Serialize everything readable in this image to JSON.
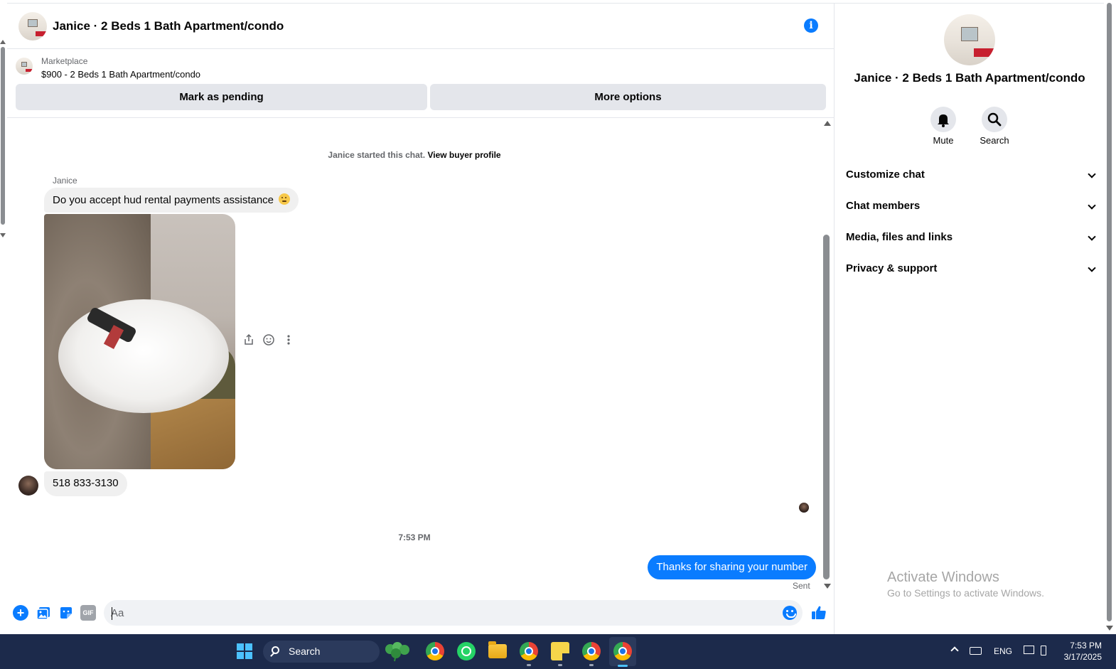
{
  "chat": {
    "title": "Janice · 2 Beds 1 Bath Apartment/condo",
    "info_icon": "info-icon"
  },
  "marketplace": {
    "label": "Marketplace",
    "item": "$900 - 2 Beds 1 Bath Apartment/condo",
    "mark_pending_label": "Mark as pending",
    "more_options_label": "More options"
  },
  "messages": {
    "started_text": "Janice started this chat.",
    "view_profile_link": "View buyer profile",
    "sender_name": "Janice",
    "msg1": "Do you accept hud rental payments assistance",
    "msg1_emoji": "thinking-face",
    "msg2": "518 833-3130",
    "timestamp": "7:53 PM",
    "msg3": "Thanks for sharing your number",
    "sent_status": "Sent"
  },
  "composer": {
    "placeholder": "Aa",
    "gif_label": "GIF"
  },
  "panel": {
    "title": "Janice · 2 Beds 1 Bath Apartment/condo",
    "mute_label": "Mute",
    "search_label": "Search",
    "sections": [
      "Customize chat",
      "Chat members",
      "Media, files and links",
      "Privacy & support"
    ]
  },
  "watermark": {
    "title": "Activate Windows",
    "subtitle": "Go to Settings to activate Windows."
  },
  "taskbar": {
    "search_label": "Search",
    "lang": "ENG",
    "time": "7:53 PM",
    "date": "3/17/2025"
  },
  "colors": {
    "accent": "#0a7cff",
    "bubble_in": "#f0f0f0",
    "taskbar": "#1c2a4b"
  }
}
